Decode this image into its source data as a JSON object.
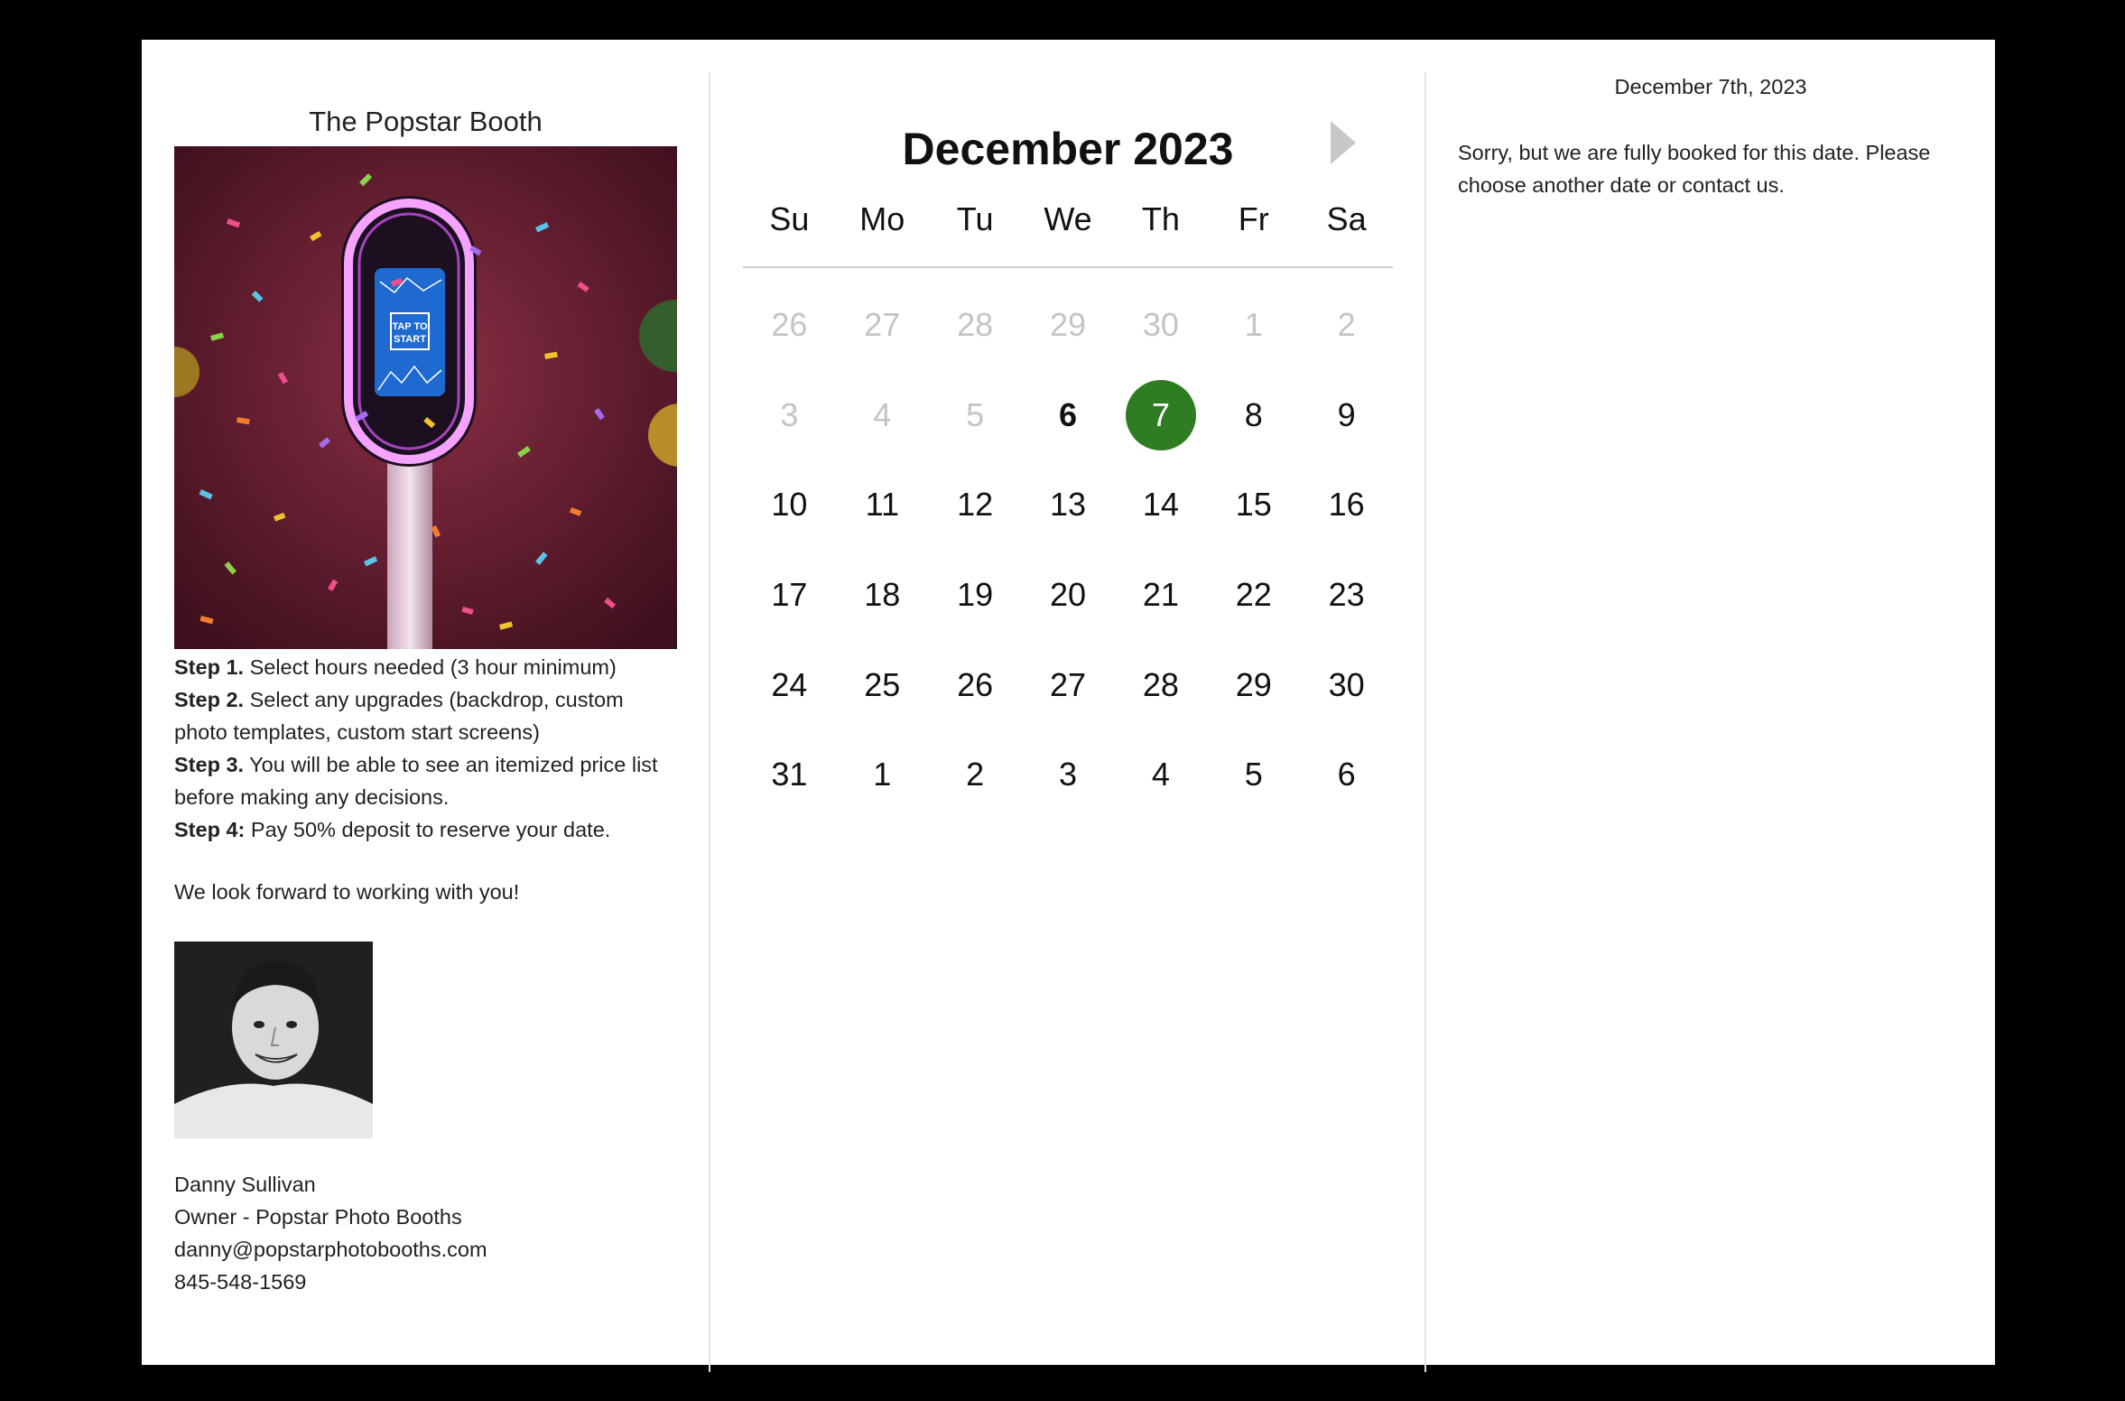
{
  "colors": {
    "background": "#000000",
    "panel": "#ffffff",
    "selected_day": "#2f7d22",
    "muted_day": "#c4c4c4",
    "text": "#222222"
  },
  "booth": {
    "title": "The Popstar Booth",
    "photo_screen_text_1": "TAP TO",
    "photo_screen_text_2": "START"
  },
  "steps": [
    {
      "label": "Step 1.",
      "text": " Select hours needed (3 hour minimum)"
    },
    {
      "label": "Step 2.",
      "text": " Select any upgrades (backdrop, custom photo templates, custom start screens)"
    },
    {
      "label": "Step 3.",
      "text": " You will be able to see an itemized price list before making any decisions."
    },
    {
      "label": "Step 4:",
      "text": " Pay 50% deposit to reserve your date."
    }
  ],
  "closing": "We look forward to working with you!",
  "contact": {
    "name": "Danny Sullivan",
    "role": "Owner - Popstar Photo Booths",
    "email": "danny@popstarphotobooths.com",
    "phone": "845-548-1569"
  },
  "calendar": {
    "title": "December 2023",
    "next_icon": "triangle-right-icon",
    "weekdays": [
      "Su",
      "Mo",
      "Tu",
      "We",
      "Th",
      "Fr",
      "Sa"
    ],
    "weeks": [
      [
        {
          "d": "26",
          "s": "muted"
        },
        {
          "d": "27",
          "s": "muted"
        },
        {
          "d": "28",
          "s": "muted"
        },
        {
          "d": "29",
          "s": "muted"
        },
        {
          "d": "30",
          "s": "muted"
        },
        {
          "d": "1",
          "s": "muted"
        },
        {
          "d": "2",
          "s": "muted"
        }
      ],
      [
        {
          "d": "3",
          "s": "muted"
        },
        {
          "d": "4",
          "s": "muted"
        },
        {
          "d": "5",
          "s": "muted"
        },
        {
          "d": "6",
          "s": "bold"
        },
        {
          "d": "7",
          "s": "selected"
        },
        {
          "d": "8",
          "s": ""
        },
        {
          "d": "9",
          "s": ""
        }
      ],
      [
        {
          "d": "10",
          "s": ""
        },
        {
          "d": "11",
          "s": ""
        },
        {
          "d": "12",
          "s": ""
        },
        {
          "d": "13",
          "s": ""
        },
        {
          "d": "14",
          "s": ""
        },
        {
          "d": "15",
          "s": ""
        },
        {
          "d": "16",
          "s": ""
        }
      ],
      [
        {
          "d": "17",
          "s": ""
        },
        {
          "d": "18",
          "s": ""
        },
        {
          "d": "19",
          "s": ""
        },
        {
          "d": "20",
          "s": ""
        },
        {
          "d": "21",
          "s": ""
        },
        {
          "d": "22",
          "s": ""
        },
        {
          "d": "23",
          "s": ""
        }
      ],
      [
        {
          "d": "24",
          "s": ""
        },
        {
          "d": "25",
          "s": ""
        },
        {
          "d": "26",
          "s": ""
        },
        {
          "d": "27",
          "s": ""
        },
        {
          "d": "28",
          "s": ""
        },
        {
          "d": "29",
          "s": ""
        },
        {
          "d": "30",
          "s": ""
        }
      ],
      [
        {
          "d": "31",
          "s": ""
        },
        {
          "d": "1",
          "s": ""
        },
        {
          "d": "2",
          "s": ""
        },
        {
          "d": "3",
          "s": ""
        },
        {
          "d": "4",
          "s": ""
        },
        {
          "d": "5",
          "s": ""
        },
        {
          "d": "6",
          "s": ""
        }
      ]
    ]
  },
  "selection": {
    "date_label": "December 7th, 2023",
    "message": "Sorry, but we are fully booked for this date. Please choose another date or contact us."
  }
}
